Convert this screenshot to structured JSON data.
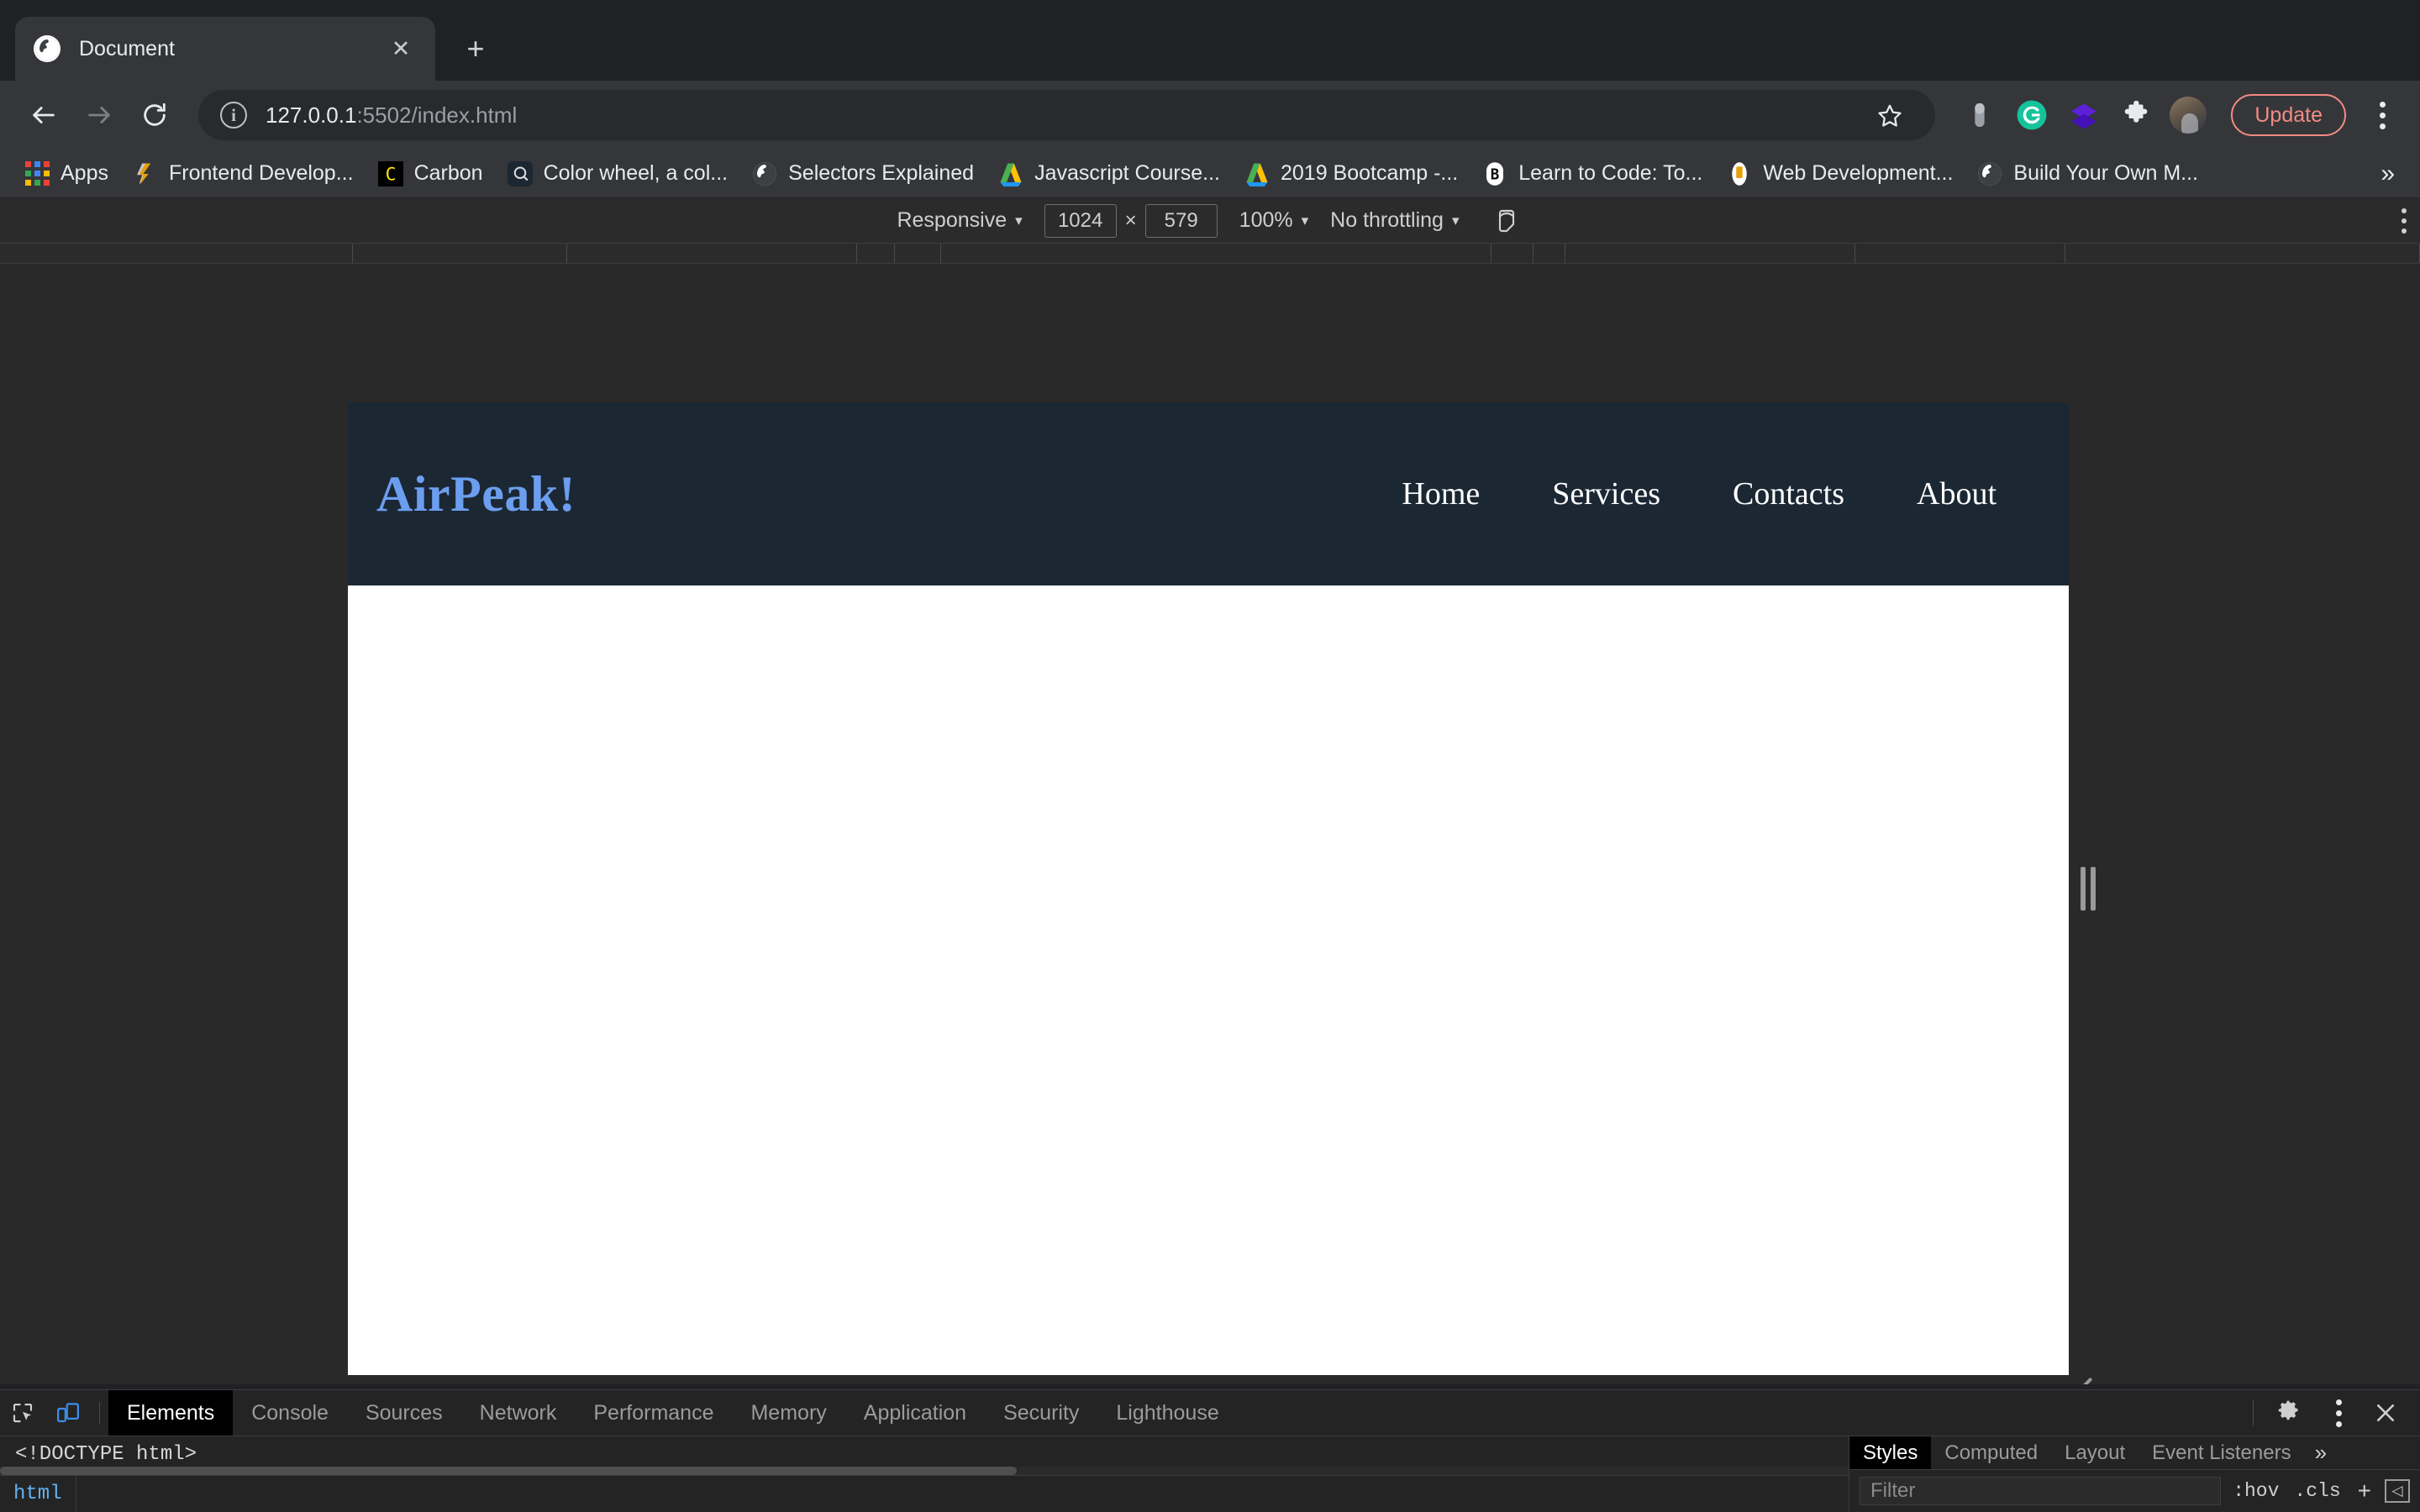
{
  "browser": {
    "tab": {
      "title": "Document",
      "favicon": "globe-icon",
      "close": "✕"
    },
    "new_tab": "+",
    "nav": {
      "back": "←",
      "forward": "→",
      "reload": "⟳"
    },
    "omnibox": {
      "info_glyph": "i",
      "host": "127.0.0.1",
      "path": ":5502/index.html",
      "star": "☆"
    },
    "extensions": [
      {
        "name": "capsule-icon",
        "label": ""
      },
      {
        "name": "grammarly-icon",
        "label": "G"
      },
      {
        "name": "layers-icon",
        "label": ""
      },
      {
        "name": "puzzle-extensions-icon",
        "label": ""
      },
      {
        "name": "avatar",
        "label": ""
      }
    ],
    "update_label": "Update",
    "menu": "kebab-menu-icon",
    "bookmarks": [
      {
        "label": "Apps",
        "icon": "apps-grid-icon"
      },
      {
        "label": "Frontend Develop...",
        "icon": "frontend-masters-icon"
      },
      {
        "label": "Carbon",
        "icon": "carbon-icon"
      },
      {
        "label": "Color wheel, a col...",
        "icon": "adobe-color-icon"
      },
      {
        "label": "Selectors Explained",
        "icon": "globe-icon"
      },
      {
        "label": "Javascript Course...",
        "icon": "google-drive-icon"
      },
      {
        "label": "2019 Bootcamp -...",
        "icon": "google-drive-icon"
      },
      {
        "label": "Learn to Code: To...",
        "icon": "bitmap-icon"
      },
      {
        "label": "Web Development...",
        "icon": "udemy-icon"
      },
      {
        "label": "Build Your Own M...",
        "icon": "globe-icon"
      }
    ],
    "bookmarks_overflow": "»"
  },
  "device_toolbar": {
    "device": "Responsive",
    "device_caret": "▾",
    "width": "1024",
    "height": "579",
    "times": "×",
    "zoom": "100%",
    "zoom_caret": "▾",
    "throttling": "No throttling",
    "throttle_caret": "▾",
    "rotate_icon": "rotate-device-icon",
    "more_icon": "kebab-menu-icon"
  },
  "page": {
    "brand": "AirPeak!",
    "brand_color": "#6c9ef0",
    "header_bg": "#1c2734",
    "nav": [
      {
        "label": "Home"
      },
      {
        "label": "Services"
      },
      {
        "label": "Contacts"
      },
      {
        "label": "About"
      }
    ]
  },
  "devtools": {
    "inspect_icon": "inspect-element-icon",
    "device_toggle_icon": "toggle-device-toolbar-icon",
    "tabs": [
      {
        "label": "Elements",
        "active": true
      },
      {
        "label": "Console",
        "active": false
      },
      {
        "label": "Sources",
        "active": false
      },
      {
        "label": "Network",
        "active": false
      },
      {
        "label": "Performance",
        "active": false
      },
      {
        "label": "Memory",
        "active": false
      },
      {
        "label": "Application",
        "active": false
      },
      {
        "label": "Security",
        "active": false
      },
      {
        "label": "Lighthouse",
        "active": false
      }
    ],
    "settings_icon": "gear-icon",
    "more_icon": "kebab-menu-icon",
    "close_icon": "close-icon",
    "elements": {
      "doctype": "<!DOCTYPE html>",
      "breadcrumb": "html"
    },
    "styles": {
      "tabs": [
        {
          "label": "Styles",
          "active": true
        },
        {
          "label": "Computed",
          "active": false
        },
        {
          "label": "Layout",
          "active": false
        },
        {
          "label": "Event Listeners",
          "active": false
        }
      ],
      "overflow": "»",
      "filter_placeholder": "Filter",
      "hov": ":hov",
      "cls": ".cls",
      "new_rule": "+",
      "sidebar_toggle": "◁"
    }
  }
}
